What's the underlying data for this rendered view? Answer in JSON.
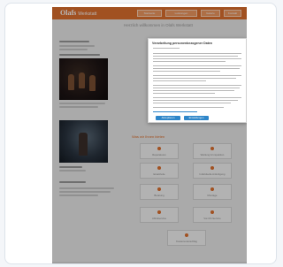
{
  "site": {
    "logo": "Olafs",
    "logo_sub": "Werkstatt"
  },
  "nav": [
    "Startseite",
    "Leistungen",
    "Galerie",
    "Kontakt"
  ],
  "page_title": "Herzlich willkommen in Olafs Werkstatt",
  "cookie_modal": {
    "title": "Verarbeitung personenbezogener Daten",
    "accept_label": "Akzeptieren",
    "settings_label": "Einstellungen"
  },
  "services_title": "Was wir Ihnen bieten",
  "services": [
    "Reparaturen",
    "Wartung & Inspektion",
    "Ersatzteile",
    "Individuelle Anfertigung",
    "Beratung",
    "Montage",
    "Abholservice",
    "Vor-Ort-Service",
    "Kostenvoranschlag"
  ],
  "colors": {
    "accent": "#e0712f",
    "modal_button": "#2e86c9"
  }
}
